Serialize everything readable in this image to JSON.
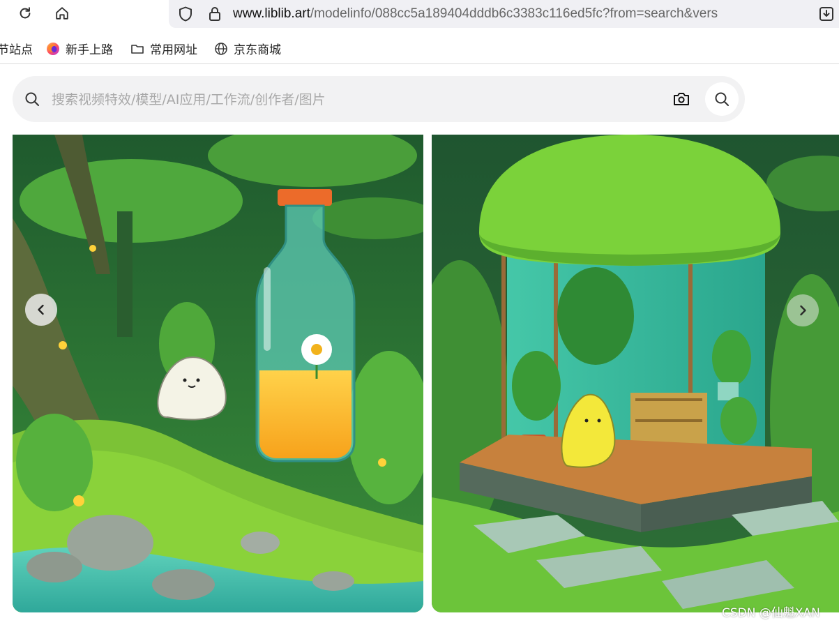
{
  "browser": {
    "url_domain": "www.liblib.art",
    "url_path": "/modelinfo/088cc5a189404dddb6c3383c116ed5fc?from=search&vers",
    "bookmarks": [
      {
        "label": "节站点",
        "icon": "none"
      },
      {
        "label": "新手上路",
        "icon": "firefox-icon"
      },
      {
        "label": "常用网址",
        "icon": "folder-icon"
      },
      {
        "label": "京东商城",
        "icon": "globe-icon"
      }
    ]
  },
  "search": {
    "placeholder": "搜索视频特效/模型/AI应用/工作流/创作者/图片"
  },
  "gallery": {
    "images": [
      {
        "description": "forest-bottle-scene"
      },
      {
        "description": "moss-greenhouse-scene"
      }
    ]
  },
  "watermark": "CSDN @仙魁XAN",
  "colors": {
    "search_bg": "#f2f2f3",
    "url_bar_bg": "#f0f0f4"
  }
}
